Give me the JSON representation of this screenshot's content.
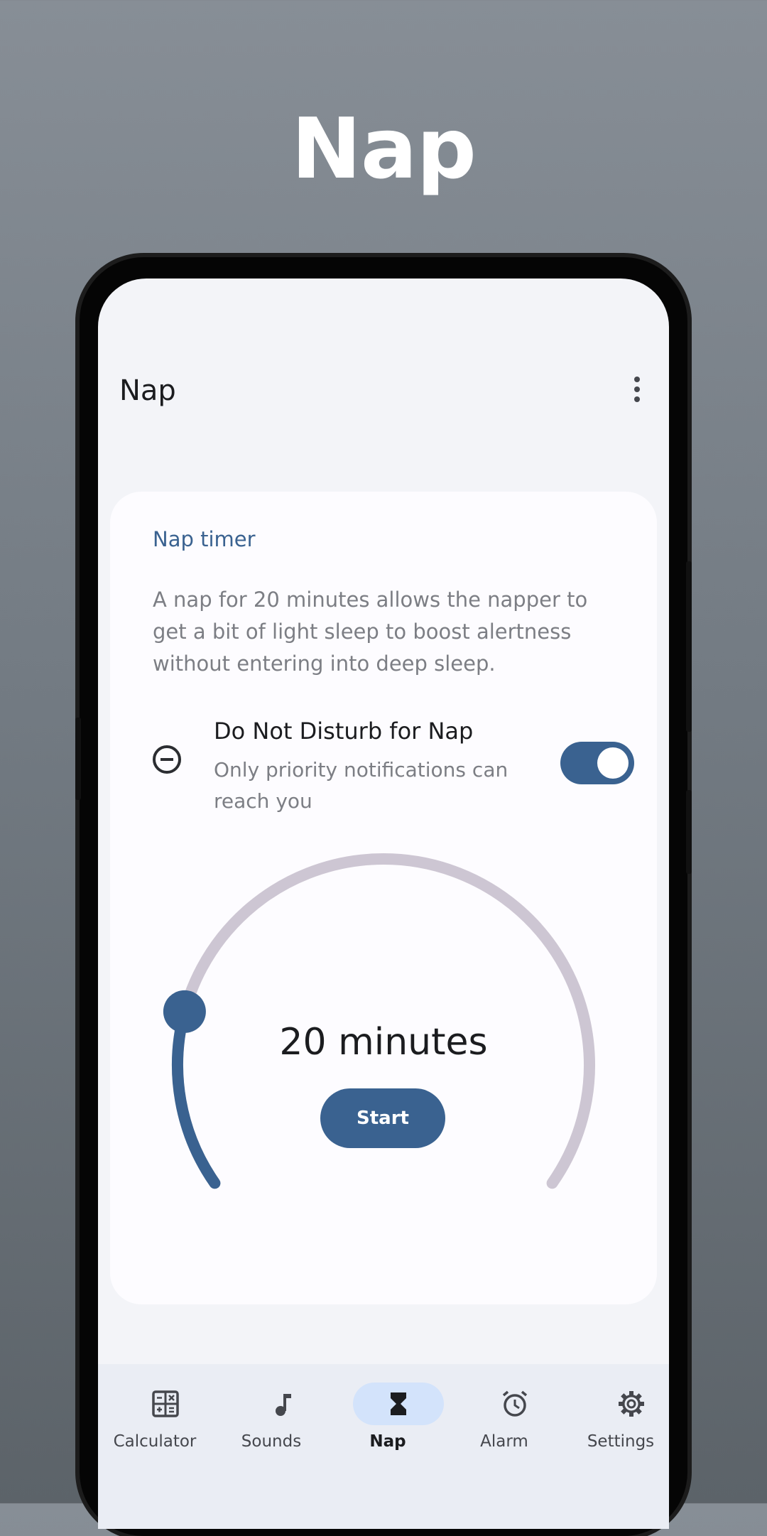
{
  "headline": "Nap",
  "appbar": {
    "title": "Nap",
    "more_icon": "more-vert-icon"
  },
  "card": {
    "title": "Nap timer",
    "description": "A nap for 20 minutes allows the napper to get a bit of light sleep to boost alertness without entering into deep sleep.",
    "dnd": {
      "title": "Do Not Disturb for Nap",
      "subtitle": "Only priority notifications can reach you",
      "icon": "do-not-disturb-icon",
      "enabled": true
    },
    "timer": {
      "value_label": "20 minutes",
      "progress_fraction": 0.2,
      "start_label": "Start"
    }
  },
  "nav": {
    "items": [
      {
        "label": "Calculator",
        "icon": "calculator-icon",
        "active": false
      },
      {
        "label": "Sounds",
        "icon": "music-note-icon",
        "active": false
      },
      {
        "label": "Nap",
        "icon": "hourglass-icon",
        "active": true
      },
      {
        "label": "Alarm",
        "icon": "alarm-clock-icon",
        "active": false
      },
      {
        "label": "Settings",
        "icon": "gear-icon",
        "active": false
      }
    ]
  },
  "colors": {
    "primary": "#3a6290",
    "track": "#cdc6d3",
    "nav_active_pill": "#d3e3fb",
    "screen_bg": "#f3f4f8"
  }
}
